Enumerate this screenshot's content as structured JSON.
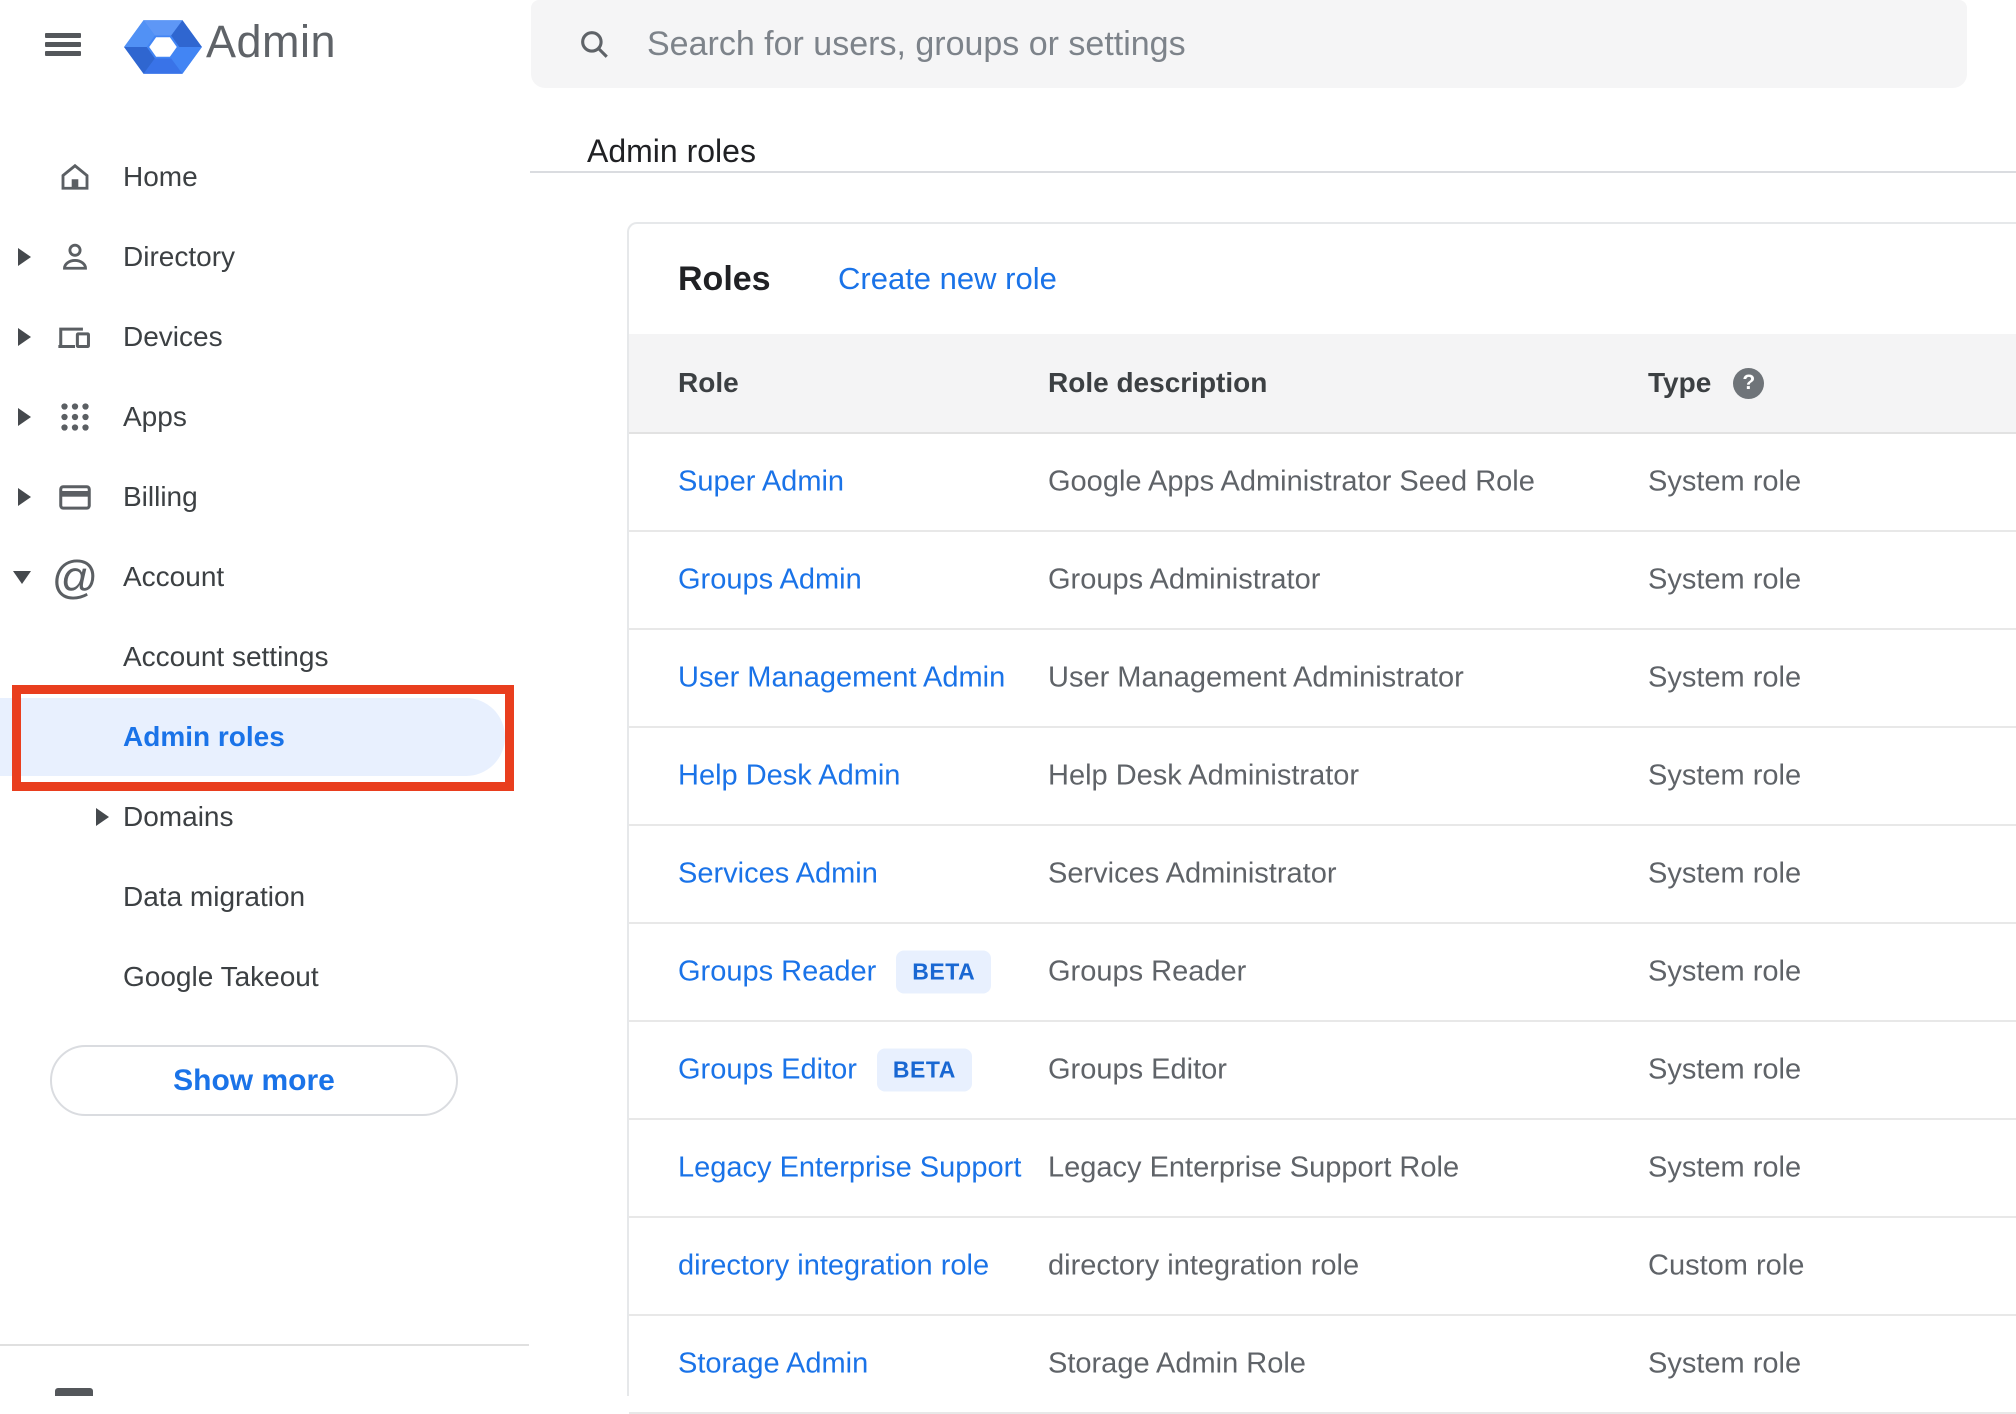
{
  "topbar": {
    "logo_text": "Admin",
    "search_placeholder": "Search for users, groups or settings"
  },
  "breadcrumb": "Admin roles",
  "sidebar": {
    "items": [
      {
        "label": "Home"
      },
      {
        "label": "Directory"
      },
      {
        "label": "Devices"
      },
      {
        "label": "Apps"
      },
      {
        "label": "Billing"
      },
      {
        "label": "Account"
      },
      {
        "label": "Account settings"
      },
      {
        "label": "Admin roles",
        "selected": true
      },
      {
        "label": "Domains"
      },
      {
        "label": "Data migration"
      },
      {
        "label": "Google Takeout"
      }
    ],
    "show_more_label": "Show more"
  },
  "roles_panel": {
    "title": "Roles",
    "create_link": "Create new role",
    "columns": {
      "role": "Role",
      "description": "Role description",
      "type": "Type"
    },
    "help_icon_glyph": "?",
    "rows": [
      {
        "role": "Super Admin",
        "description": "Google Apps Administrator Seed Role",
        "type": "System role"
      },
      {
        "role": "Groups Admin",
        "description": "Groups Administrator",
        "type": "System role"
      },
      {
        "role": "User Management Admin",
        "description": "User Management Administrator",
        "type": "System role"
      },
      {
        "role": "Help Desk Admin",
        "description": "Help Desk Administrator",
        "type": "System role"
      },
      {
        "role": "Services Admin",
        "description": "Services Administrator",
        "type": "System role"
      },
      {
        "role": "Groups Reader",
        "badge": "BETA",
        "description": "Groups Reader",
        "type": "System role"
      },
      {
        "role": "Groups Editor",
        "badge": "BETA",
        "description": "Groups Editor",
        "type": "System role"
      },
      {
        "role": "Legacy Enterprise Support",
        "description": "Legacy Enterprise Support Role",
        "type": "System role"
      },
      {
        "role": "directory integration role",
        "description": "directory integration role",
        "type": "Custom role"
      },
      {
        "role": "Storage Admin",
        "description": "Storage Admin Role",
        "type": "System role"
      }
    ]
  },
  "colors": {
    "accent_blue": "#1a73e8",
    "selected_pill_bg": "#e8f0fe",
    "annotation_red": "#e93e1e",
    "badge_bg": "#e8f0fe",
    "badge_text": "#1967d2",
    "icon_gray": "#5b5f63",
    "text_dark": "#202124",
    "text_gray": "#5f6368"
  }
}
